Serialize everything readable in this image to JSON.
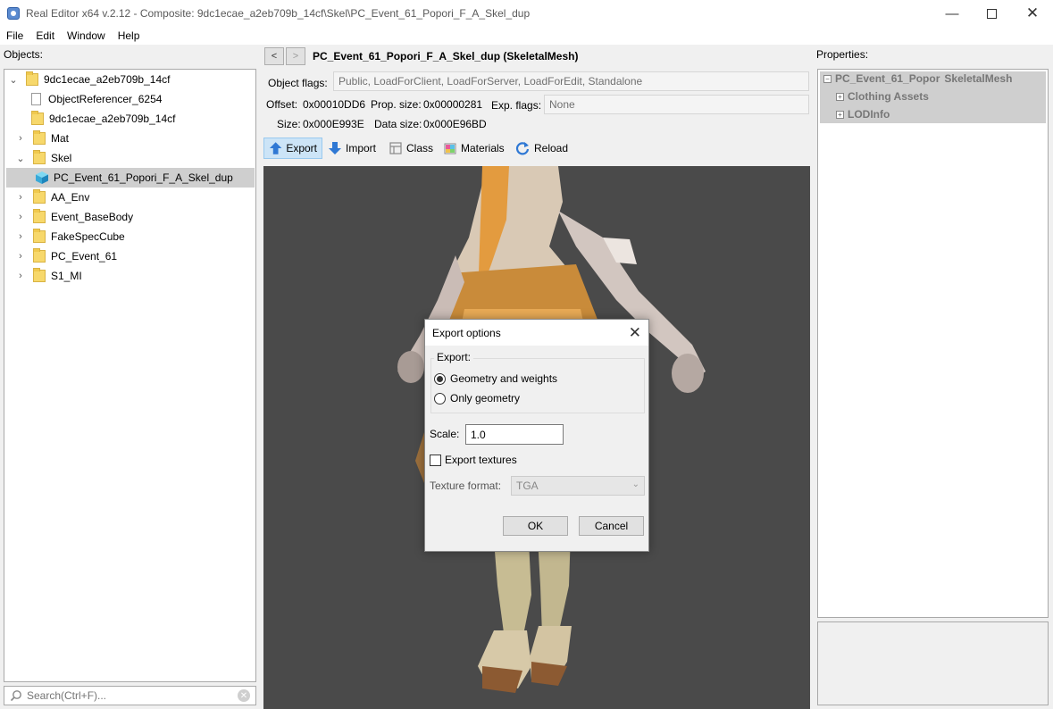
{
  "window": {
    "title": "Real Editor x64 v.2.12 - Composite: 9dc1ecae_a2eb709b_14cf\\Skel\\PC_Event_61_Popori_F_A_Skel_dup",
    "minimize_glyph": "—",
    "maximize_icon": "square-icon",
    "close_glyph": "✕"
  },
  "menu": [
    "File",
    "Edit",
    "Window",
    "Help"
  ],
  "objects_panel": {
    "label": "Objects:",
    "tree": [
      {
        "label": "9dc1ecae_a2eb709b_14cf",
        "icon": "folder-icon",
        "expander": "expanded"
      },
      {
        "label": "ObjectReferencer_6254",
        "icon": "file-icon",
        "expander": "none"
      },
      {
        "label": "9dc1ecae_a2eb709b_14cf",
        "icon": "folder-icon",
        "expander": "none"
      },
      {
        "label": "Mat",
        "icon": "folder-icon",
        "expander": "collapsed"
      },
      {
        "label": "Skel",
        "icon": "folder-icon",
        "expander": "expanded"
      },
      {
        "label": "PC_Event_61_Popori_F_A_Skel_dup",
        "icon": "skeletal-mesh-icon",
        "expander": "none",
        "selected": true
      },
      {
        "label": "AA_Env",
        "icon": "folder-icon",
        "expander": "collapsed"
      },
      {
        "label": "Event_BaseBody",
        "icon": "folder-icon",
        "expander": "collapsed"
      },
      {
        "label": "FakeSpecCube",
        "icon": "folder-icon",
        "expander": "collapsed"
      },
      {
        "label": "PC_Event_61",
        "icon": "folder-icon",
        "expander": "collapsed"
      },
      {
        "label": "S1_MI",
        "icon": "folder-icon",
        "expander": "collapsed"
      }
    ],
    "search": {
      "placeholder": "Search(Ctrl+F)...",
      "clear_glyph": "✕"
    }
  },
  "object_view": {
    "back_glyph": "<",
    "forward_glyph": ">",
    "title": "PC_Event_61_Popori_F_A_Skel_dup (SkeletalMesh)",
    "object_flags_label": "Object flags:",
    "object_flags_value": "Public, LoadForClient, LoadForServer, LoadForEdit, Standalone",
    "offset_label": "Offset:",
    "offset_value": "0x00010DD6",
    "prop_size_label": "Prop. size:",
    "prop_size_value": "0x00000281",
    "exp_flags_label": "Exp. flags:",
    "exp_flags_value": "None",
    "size_label": "Size:",
    "size_value": "0x000E993E",
    "data_size_label": "Data size:",
    "data_size_value": "0x000E96BD",
    "toolbar": {
      "export": "Export",
      "import": "Import",
      "class": "Class",
      "materials": "Materials",
      "reload": "Reload"
    },
    "viewport_color": "#4a4a4a"
  },
  "export_dialog": {
    "title": "Export options",
    "close_glyph": "✕",
    "group_label": "Export:",
    "options": [
      "Geometry and weights",
      "Only geometry"
    ],
    "selected_option": "Geometry and weights",
    "scale_label": "Scale:",
    "scale_value": "1.0",
    "export_textures_label": "Export textures",
    "export_textures_checked": false,
    "texture_format_label": "Texture format:",
    "texture_format_value": "TGA",
    "ok_label": "OK",
    "cancel_label": "Cancel"
  },
  "properties_panel": {
    "label": "Properties:",
    "root_name": "PC_Event_61_Popor",
    "root_type": "SkeletalMesh",
    "children": [
      "Clothing Assets",
      "LODInfo"
    ],
    "expander_glyph": "+",
    "collapse_glyph": "−"
  }
}
